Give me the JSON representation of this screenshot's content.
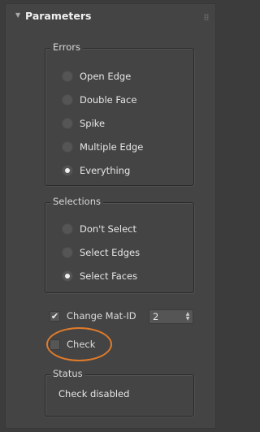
{
  "rollout": {
    "title": "Parameters"
  },
  "errors": {
    "label": "Errors",
    "options": [
      {
        "label": "Open Edge",
        "selected": false
      },
      {
        "label": "Double Face",
        "selected": false
      },
      {
        "label": "Spike",
        "selected": false
      },
      {
        "label": "Multiple Edge",
        "selected": false
      },
      {
        "label": "Everything",
        "selected": true
      }
    ]
  },
  "selections": {
    "label": "Selections",
    "options": [
      {
        "label": "Don't Select",
        "selected": false
      },
      {
        "label": "Select Edges",
        "selected": false
      },
      {
        "label": "Select Faces",
        "selected": true
      }
    ]
  },
  "change_mat_id": {
    "label": "Change Mat-ID",
    "checked": true,
    "value": "2"
  },
  "check": {
    "label": "Check",
    "checked": false
  },
  "status": {
    "label": "Status",
    "text": "Check disabled"
  },
  "colors": {
    "panel": "#444444",
    "background": "#3c3c3c",
    "highlight": "#e07b2a"
  },
  "icons": {
    "collapse": "collapse-triangle-icon",
    "check": "checkmark-icon",
    "spinner": "spinner-arrows-icon",
    "grip": "grip-icon"
  }
}
